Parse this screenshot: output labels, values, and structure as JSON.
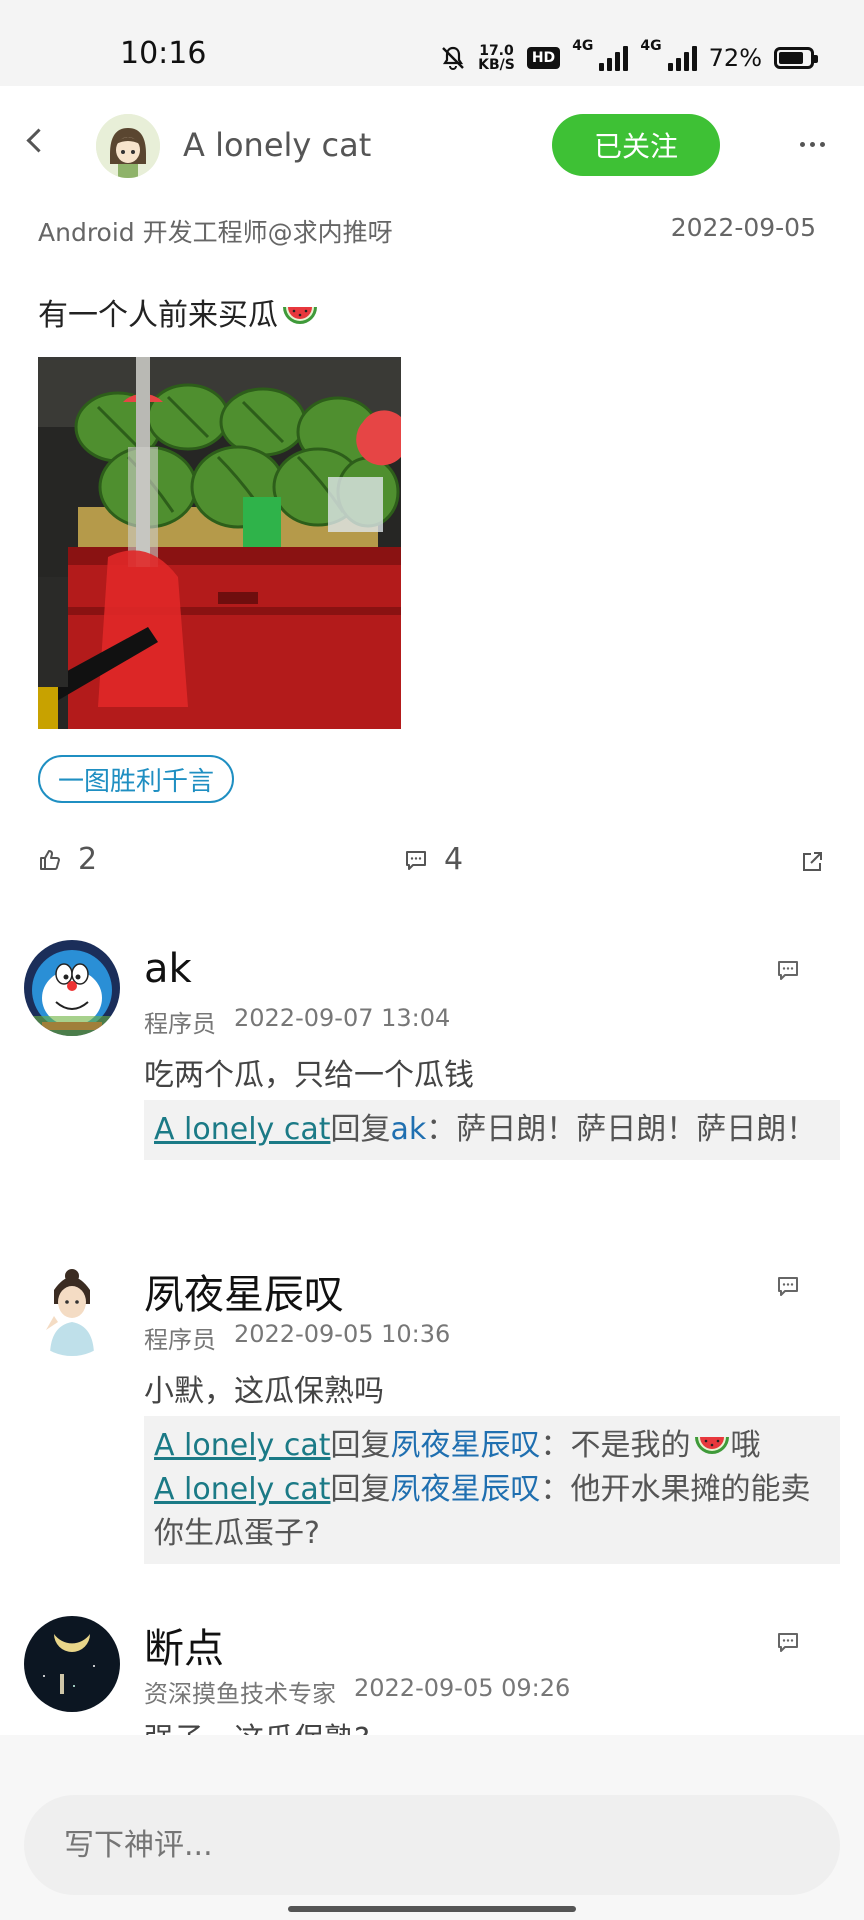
{
  "status_bar": {
    "time": "10:16",
    "net_speed_value": "17.0",
    "net_speed_unit": "KB/S",
    "hd_label": "HD",
    "net1": "4G",
    "net2": "4G",
    "battery": "72%"
  },
  "header": {
    "back_icon": "chevron-left-icon",
    "username": "A lonely cat",
    "follow_label": "已关注",
    "more_icon": "more-dots-icon",
    "accent": "#3ec135"
  },
  "post": {
    "author_title": "Android 开发工程师@求内推呀",
    "date": "2022-09-05",
    "text": "有一个人前来买瓜",
    "tag": "一图胜利千言",
    "likes": "2",
    "comments": "4"
  },
  "comments": [
    {
      "name": "ak",
      "role": "程序员",
      "time": "2022-09-07 13:04",
      "text": "吃两个瓜，只给一个瓜钱",
      "replies": [
        {
          "author": "A lonely cat",
          "verb": "回复",
          "target": "ak",
          "text": "：萨日朗！萨日朗！萨日朗！"
        }
      ]
    },
    {
      "name": "夙夜星辰叹",
      "role": "程序员",
      "time": "2022-09-05 10:36",
      "text": "小默，这瓜保熟吗",
      "replies": [
        {
          "author": "A lonely cat",
          "verb": "回复",
          "target": "夙夜星辰叹",
          "text": "：不是我的",
          "suffix": "哦"
        },
        {
          "author": "A lonely cat",
          "verb": "回复",
          "target": "夙夜星辰叹",
          "text": "：他开水果摊的能卖你生瓜蛋子?"
        }
      ]
    },
    {
      "name": "断点",
      "role": "资深摸鱼技术专家",
      "time": "2022-09-05 09:26",
      "text": "强子，这瓜保熟?",
      "replies": []
    }
  ],
  "input": {
    "placeholder": "写下神评..."
  }
}
